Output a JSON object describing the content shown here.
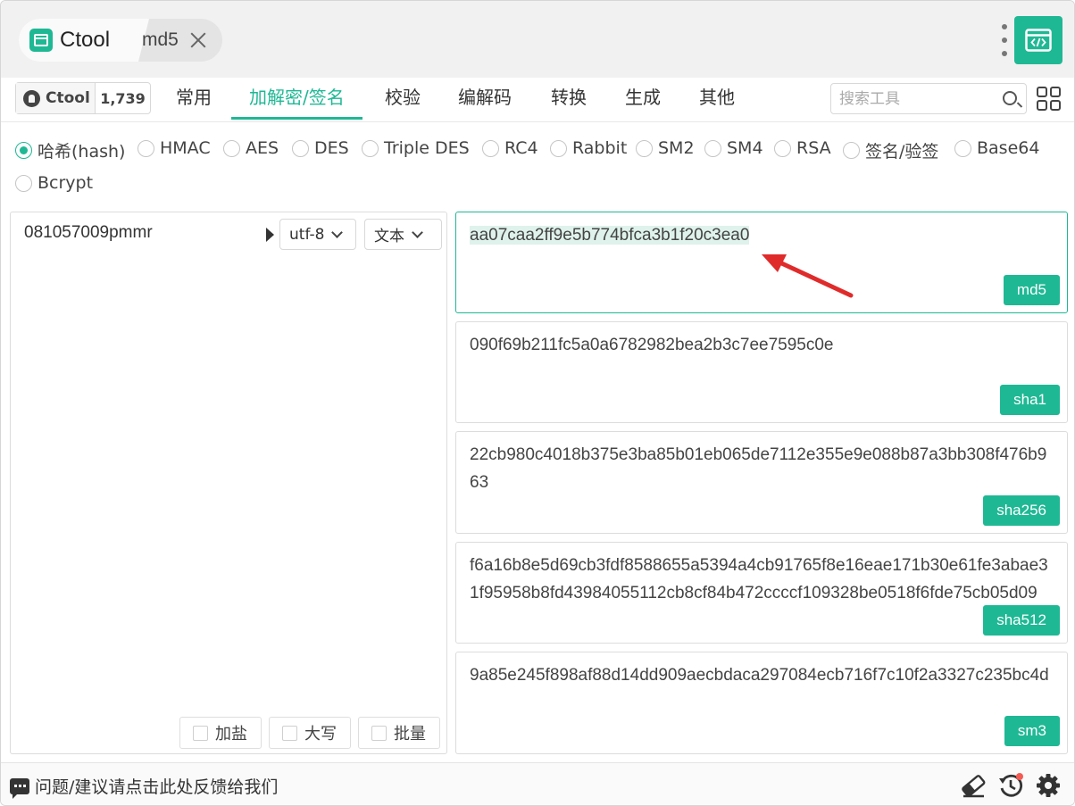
{
  "titlebar": {
    "app_name": "Ctool",
    "tab_label": "md5"
  },
  "github": {
    "label": "Ctool",
    "stars": "1,739"
  },
  "nav": {
    "items": [
      "常用",
      "加解密/签名",
      "校验",
      "编解码",
      "转换",
      "生成",
      "其他"
    ],
    "active": "加解密/签名",
    "search_placeholder": "搜索工具"
  },
  "algorithms": {
    "options": [
      "哈希(hash)",
      "HMAC",
      "AES",
      "DES",
      "Triple DES",
      "RC4",
      "Rabbit",
      "SM2",
      "SM4",
      "RSA",
      "签名/验签",
      "Base64",
      "Bcrypt"
    ],
    "selected": "哈希(hash)"
  },
  "input": {
    "value": "081057009pmmr",
    "encoding": "utf-8",
    "type": "文本",
    "options": [
      "加盐",
      "大写",
      "批量"
    ]
  },
  "outputs": [
    {
      "value": "aa07caa2ff9e5b774bfca3b1f20c3ea0",
      "label": "md5"
    },
    {
      "value": "090f69b211fc5a0a6782982bea2b3c7ee7595c0e",
      "label": "sha1"
    },
    {
      "value": "22cb980c4018b375e3ba85b01eb065de7112e355e9e088b87a3bb308f476b963",
      "label": "sha256"
    },
    {
      "value": "f6a16b8e5d69cb3fdf8588655a5394a4cb91765f8e16eae171b30e61fe3abae31f95958b8fd43984055112cb8cf84b472ccccf109328be0518f6fde75cb05d09",
      "label": "sha512"
    },
    {
      "value": "9a85e245f898af88d14dd909aecbdaca297084ecb716f7c10f2a3327c235bc4d",
      "label": "sm3"
    }
  ],
  "footer": {
    "feedback": "问题/建议请点击此处反馈给我们"
  },
  "colors": {
    "accent": "#1fb894",
    "annotation_arrow": "#e02b2b",
    "notification_dot": "#f25c54"
  }
}
